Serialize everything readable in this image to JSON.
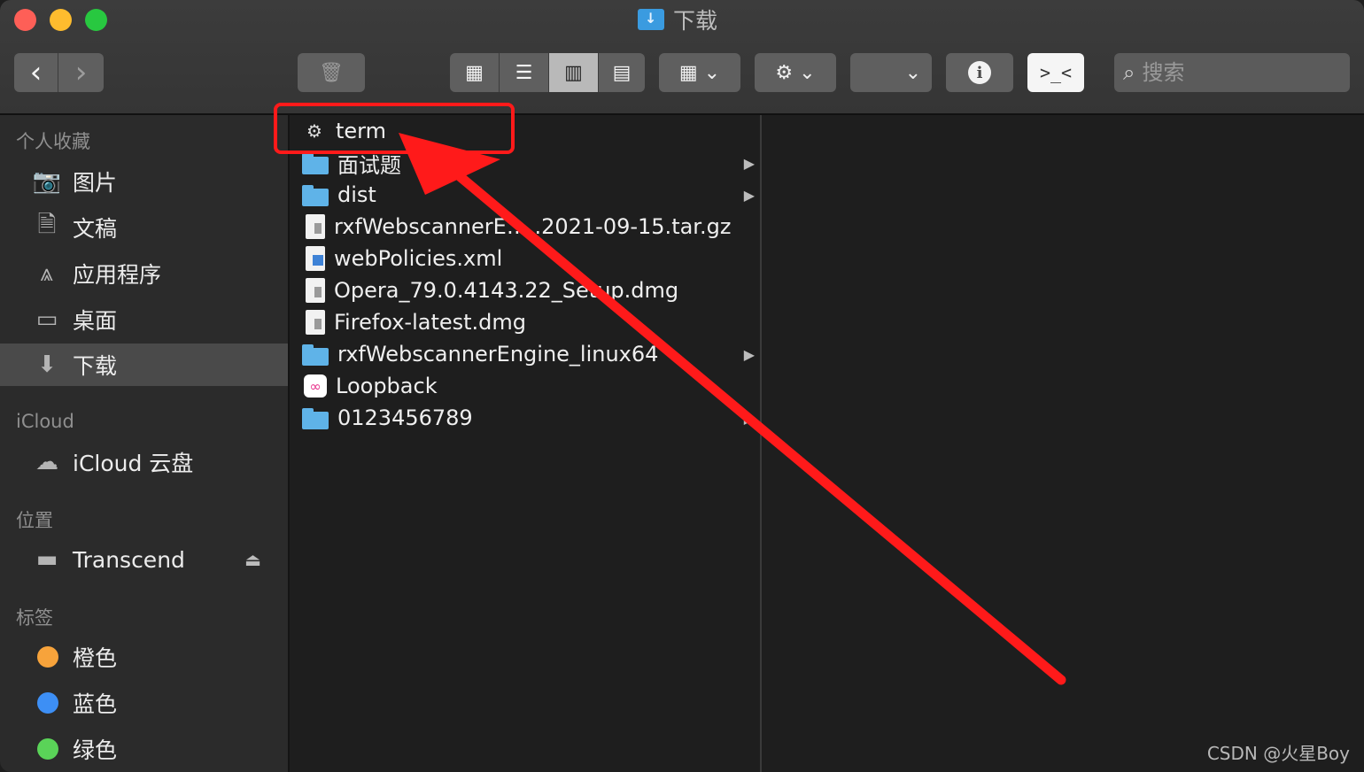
{
  "window": {
    "title": "下载"
  },
  "toolbar": {
    "back_glyph": "‹",
    "forward_glyph": "›",
    "trash_glyph": "🗑",
    "views": [
      "▦",
      "☰",
      "▥",
      "▤"
    ],
    "group_glyph": "▦ ⌄",
    "action_glyph": "⚙ ⌄",
    "share_glyph": "⌄",
    "info_glyph": "i",
    "terminal_glyph": ">_<",
    "search_placeholder": "搜索"
  },
  "sidebar": {
    "favorites_title": "个人收藏",
    "favorites": [
      {
        "label": "图片",
        "icon": "camera-icon",
        "glyph": "📷"
      },
      {
        "label": "文稿",
        "icon": "document-icon",
        "glyph": "🗎"
      },
      {
        "label": "应用程序",
        "icon": "applications-icon",
        "glyph": "⩓"
      },
      {
        "label": "桌面",
        "icon": "desktop-icon",
        "glyph": "▭"
      },
      {
        "label": "下载",
        "icon": "download-icon",
        "glyph": "⬇"
      }
    ],
    "icloud_title": "iCloud",
    "icloud": [
      {
        "label": "iCloud 云盘",
        "icon": "cloud-icon",
        "glyph": "☁"
      }
    ],
    "locations_title": "位置",
    "locations": [
      {
        "label": "Transcend",
        "icon": "drive-icon",
        "glyph": "▬",
        "eject": "⏏"
      }
    ],
    "tags_title": "标签",
    "tags": [
      {
        "label": "橙色",
        "color": "#f7a33b"
      },
      {
        "label": "蓝色",
        "color": "#3d8ff5"
      },
      {
        "label": "绿色",
        "color": "#5ad358"
      }
    ]
  },
  "files": [
    {
      "name": "term",
      "type": "app",
      "has_children": false
    },
    {
      "name": "面试题",
      "type": "folder",
      "has_children": true
    },
    {
      "name": "dist",
      "type": "folder",
      "has_children": true
    },
    {
      "name": "rxfWebscannerE…..2021-09-15.tar.gz",
      "type": "archive",
      "has_children": false
    },
    {
      "name": "webPolicies.xml",
      "type": "xml",
      "has_children": false
    },
    {
      "name": "Opera_79.0.4143.22_Setup.dmg",
      "type": "dmg",
      "has_children": false
    },
    {
      "name": "Firefox-latest.dmg",
      "type": "dmg",
      "has_children": false
    },
    {
      "name": "rxfWebscannerEngine_linux64",
      "type": "folder",
      "has_children": true
    },
    {
      "name": "Loopback",
      "type": "loopback-app",
      "has_children": false
    },
    {
      "name": "0123456789",
      "type": "folder",
      "has_children": true
    }
  ],
  "annotation": {
    "color": "#ff1a1a"
  },
  "watermark": "CSDN @火星Boy"
}
